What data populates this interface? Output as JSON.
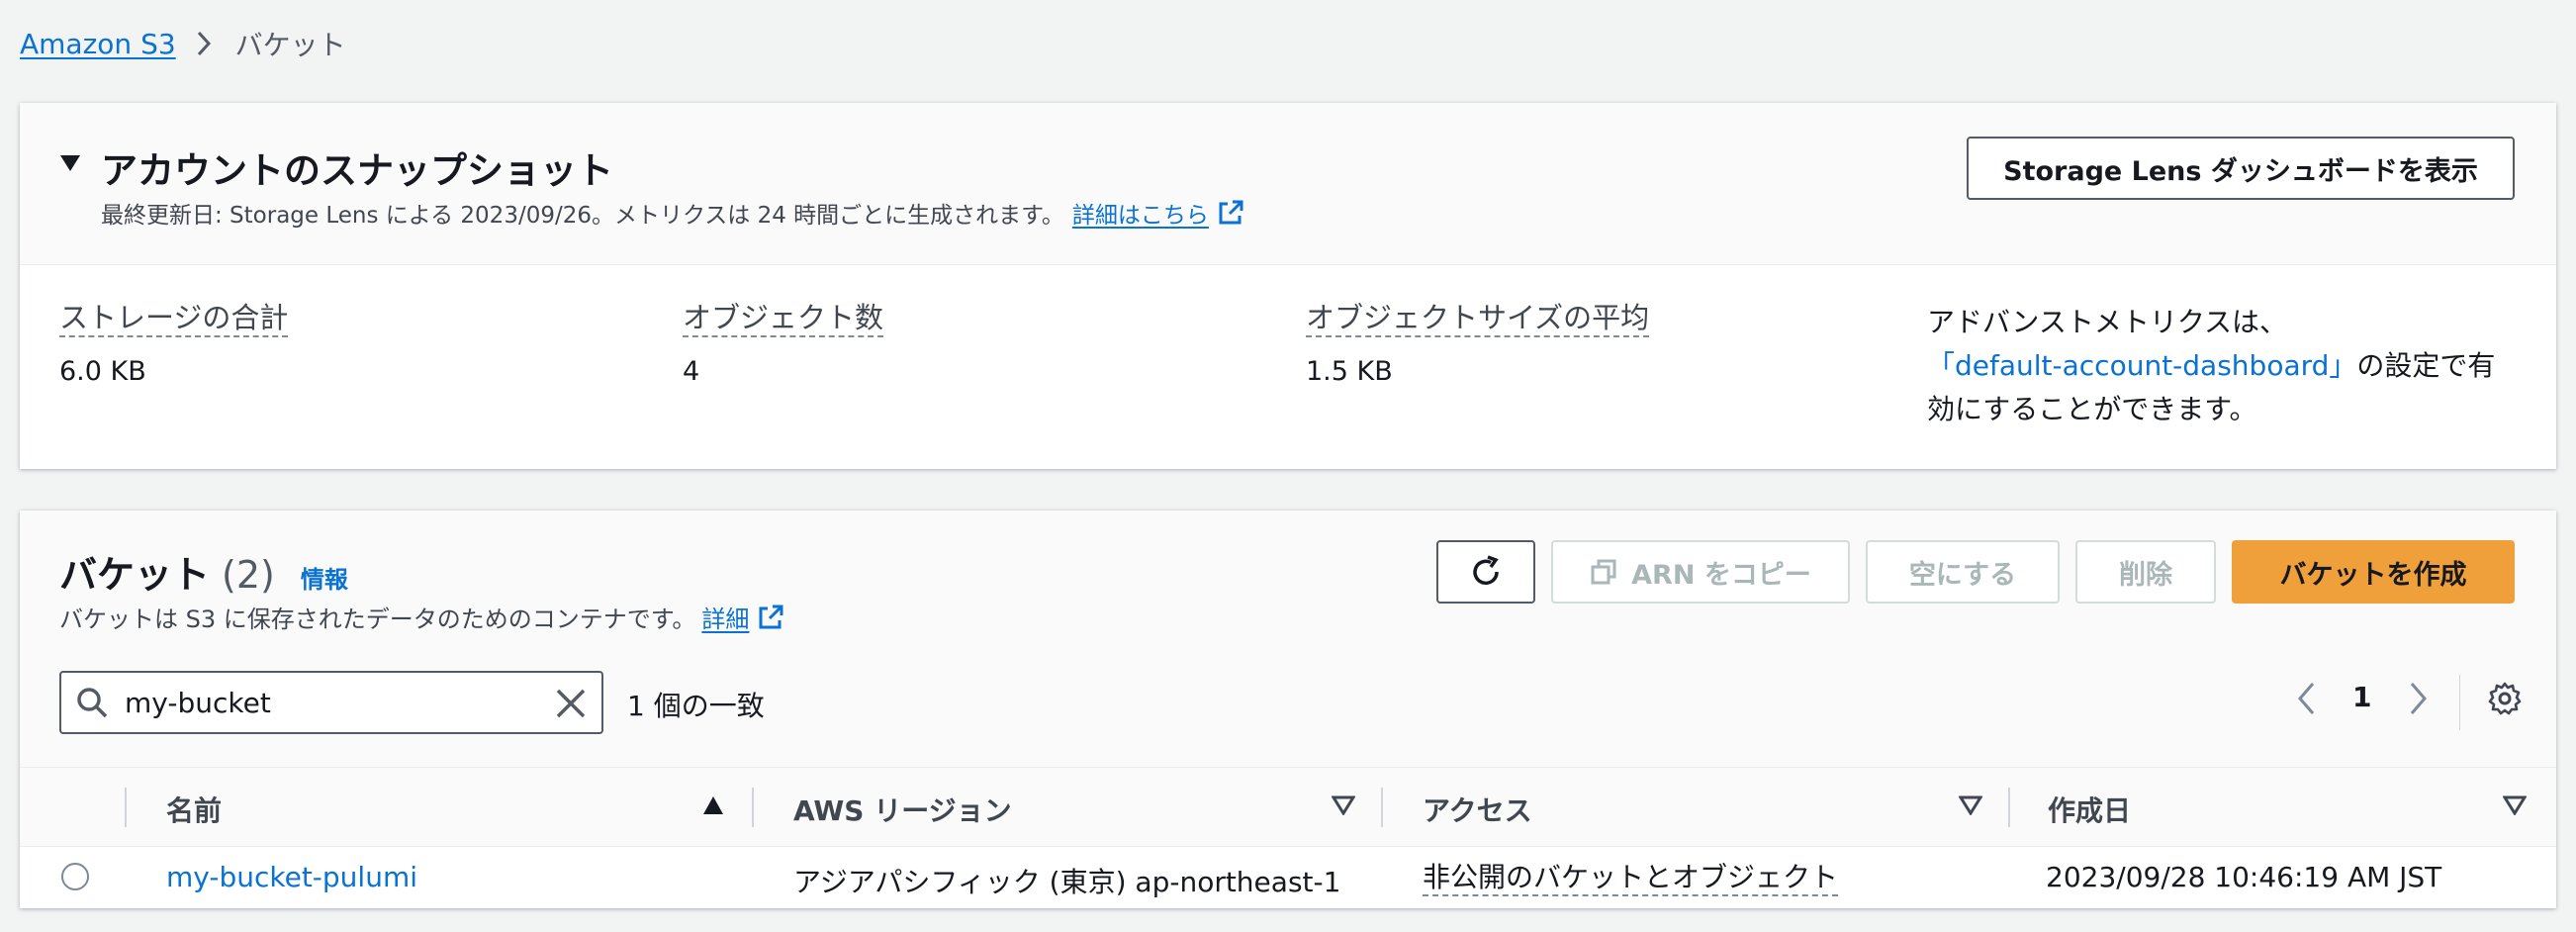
{
  "breadcrumb": {
    "root": "Amazon S3",
    "current": "バケット"
  },
  "snapshot": {
    "title": "アカウントのスナップショット",
    "subtitle": "最終更新日: Storage Lens による 2023/09/26。メトリクスは 24 時間ごとに生成されます。",
    "details_link": "詳細はこちら",
    "lens_button": "Storage Lens ダッシュボードを表示",
    "metrics": [
      {
        "label": "ストレージの合計",
        "value": "6.0 KB"
      },
      {
        "label": "オブジェクト数",
        "value": "4"
      },
      {
        "label": "オブジェクトサイズの平均",
        "value": "1.5 KB"
      }
    ],
    "advanced": {
      "prefix": "アドバンストメトリクスは、",
      "link": "「default-account-dashboard」",
      "suffix": "の設定で有効にすることができます。"
    }
  },
  "buckets": {
    "title": "バケット",
    "count": "(2)",
    "info": "情報",
    "subtitle": "バケットは S3 に保存されたデータのためのコンテナです。",
    "details_link": "詳細",
    "buttons": {
      "copy_arn": "ARN をコピー",
      "empty": "空にする",
      "delete": "削除",
      "create": "バケットを作成"
    },
    "search": {
      "value": "my-bucket",
      "placeholder": ""
    },
    "match_count": "1 個の一致",
    "page": "1",
    "columns": [
      "名前",
      "AWS リージョン",
      "アクセス",
      "作成日"
    ],
    "rows": [
      {
        "name": "my-bucket-pulumi",
        "region": "アジアパシフィック (東京) ap-northeast-1",
        "access": "非公開のバケットとオブジェクト",
        "created": "2023/09/28 10:46:19 AM JST"
      }
    ]
  },
  "colors": {
    "link": "#0972d3",
    "primary_button": "#f0a03b",
    "background": "#f2f3f3"
  }
}
